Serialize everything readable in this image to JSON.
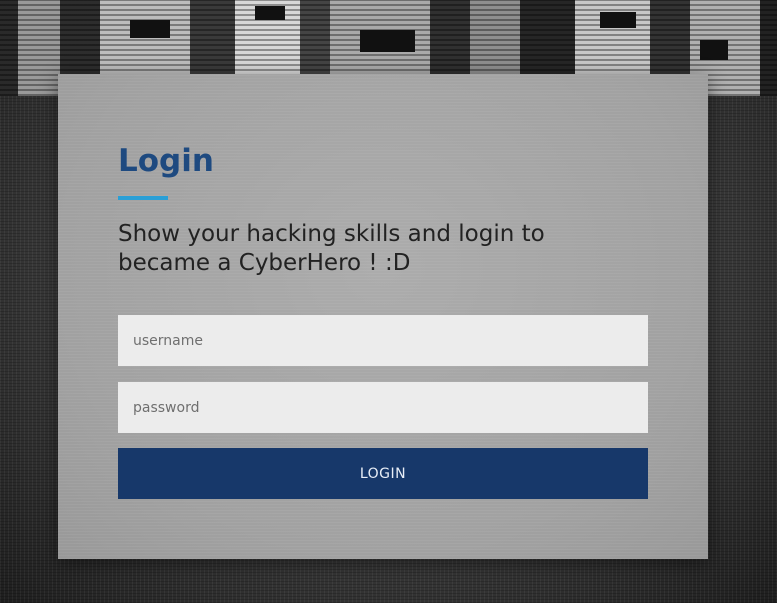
{
  "login": {
    "title": "Login",
    "subtitle": "Show your hacking skills and login to became a CyberHero ! :D",
    "username_placeholder": "username",
    "password_placeholder": "password",
    "button_label": "LOGIN"
  },
  "colors": {
    "title": "#1e4a80",
    "underline_accent": "#2a9fd6",
    "button_background": "#17386a",
    "card_background": "#a4a4a4"
  }
}
